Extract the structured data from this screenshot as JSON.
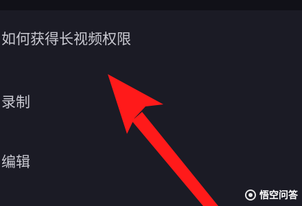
{
  "menu": {
    "items": [
      {
        "label": "如何获得长视频权限"
      },
      {
        "label": "录制"
      },
      {
        "label": "编辑"
      }
    ]
  },
  "annotation": {
    "arrow_color": "#ff1a1a",
    "arrow_icon": "red-arrow-icon"
  },
  "watermark": {
    "text": "悟空问答",
    "logo_icon": "wukong-logo-icon"
  },
  "colors": {
    "background": "#1b1b25",
    "text": "#c9c9d1"
  }
}
